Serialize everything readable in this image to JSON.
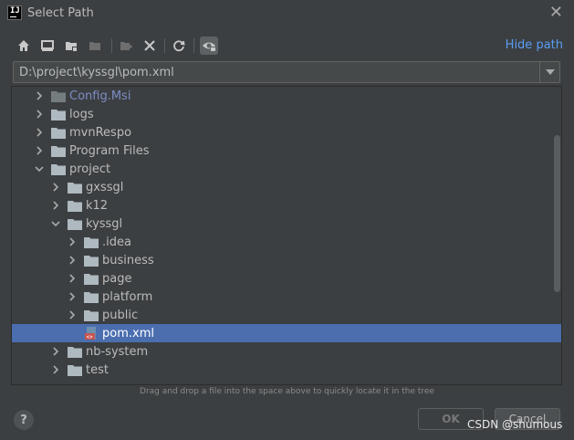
{
  "window": {
    "title": "Select Path",
    "app_icon_text": "IJ"
  },
  "toolbar": {
    "buttons": [
      {
        "icon": "home-icon"
      },
      {
        "icon": "desktop-icon"
      },
      {
        "icon": "project-folder-icon"
      },
      {
        "icon": "module-folder-icon"
      },
      {
        "icon": "new-folder-icon"
      },
      {
        "icon": "delete-icon"
      },
      {
        "icon": "refresh-icon"
      },
      {
        "icon": "show-hidden-icon"
      }
    ],
    "hide_path_label": "Hide path"
  },
  "path": {
    "value": "D:\\project\\kyssgl\\pom.xml"
  },
  "tree": {
    "items": [
      {
        "label": "Config.Msi",
        "depth": 1,
        "expanded": false,
        "type": "folder",
        "hidden": true
      },
      {
        "label": "logs",
        "depth": 1,
        "expanded": false,
        "type": "folder"
      },
      {
        "label": "mvnRespo",
        "depth": 1,
        "expanded": false,
        "type": "folder"
      },
      {
        "label": "Program Files",
        "depth": 1,
        "expanded": false,
        "type": "folder"
      },
      {
        "label": "project",
        "depth": 1,
        "expanded": true,
        "type": "folder"
      },
      {
        "label": "gxssgl",
        "depth": 2,
        "expanded": false,
        "type": "folder"
      },
      {
        "label": "k12",
        "depth": 2,
        "expanded": false,
        "type": "folder"
      },
      {
        "label": "kyssgl",
        "depth": 2,
        "expanded": true,
        "type": "folder"
      },
      {
        "label": ".idea",
        "depth": 3,
        "expanded": false,
        "type": "folder"
      },
      {
        "label": "business",
        "depth": 3,
        "expanded": false,
        "type": "folder"
      },
      {
        "label": "page",
        "depth": 3,
        "expanded": false,
        "type": "folder"
      },
      {
        "label": "platform",
        "depth": 3,
        "expanded": false,
        "type": "folder"
      },
      {
        "label": "public",
        "depth": 3,
        "expanded": false,
        "type": "folder"
      },
      {
        "label": "pom.xml",
        "depth": 3,
        "expanded": false,
        "type": "file",
        "selected": true
      },
      {
        "label": "nb-system",
        "depth": 2,
        "expanded": false,
        "type": "folder"
      },
      {
        "label": "test",
        "depth": 2,
        "expanded": false,
        "type": "folder"
      }
    ]
  },
  "hint": "Drag and drop a file into the space above to quickly locate it in the tree",
  "footer": {
    "help_label": "?",
    "ok_label": "OK",
    "cancel_label": "Cancel"
  },
  "watermark": "CSDN @shumous",
  "colors": {
    "background": "#3c3f41",
    "selection": "#4b6eaf",
    "link": "#589df6",
    "folder": "#aeb9c0"
  }
}
